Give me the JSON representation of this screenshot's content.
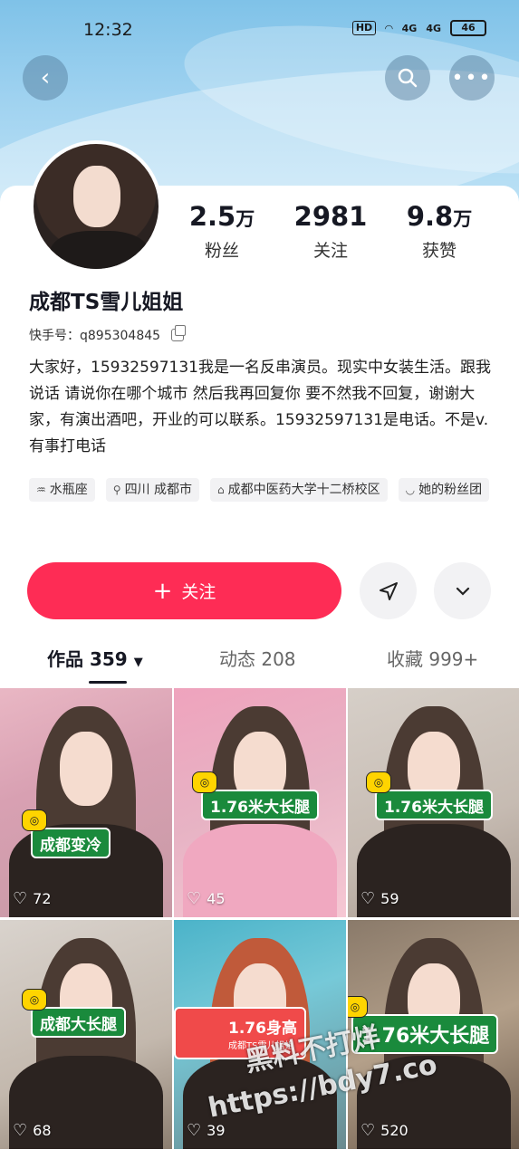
{
  "status_bar": {
    "time": "12:32",
    "hd": "HD",
    "sig1": "4G",
    "sig2": "4G",
    "battery": "46"
  },
  "header": {
    "back_icon": "chevron-left-icon",
    "search_icon": "search-icon",
    "more_icon": "ellipsis-icon"
  },
  "profile": {
    "stats": [
      {
        "num": "2.5",
        "unit": "万",
        "label": "粉丝"
      },
      {
        "num": "2981",
        "unit": "",
        "label": "关注"
      },
      {
        "num": "9.8",
        "unit": "万",
        "label": "获赞"
      }
    ],
    "username": "成都TS雪儿姐姐",
    "kuaishou_id": "快手号：q895304845",
    "bio": "大家好，15932597131我是一名反串演员。现实中女装生活。跟我说话 请说你在哪个城市 然后我再回复你 要不然我不回复，谢谢大家，有演出酒吧，开业的可以联系。15932597131是电话。不是v.有事打电话",
    "tags": [
      "水瓶座",
      "四川 成都市",
      "成都中医药大学十二桥校区",
      "她的粉丝团"
    ]
  },
  "actions": {
    "follow_label": "关注"
  },
  "tabs": [
    {
      "label": "作品 359"
    },
    {
      "label": "动态 208"
    },
    {
      "label": "收藏 999+"
    }
  ],
  "videos": [
    {
      "label": "成都变冷",
      "likes": "72"
    },
    {
      "label": "1.76米大长腿",
      "likes": "45"
    },
    {
      "label": "1.76米大长腿",
      "likes": "59"
    },
    {
      "label": "成都大长腿",
      "likes": "68"
    },
    {
      "label": "1.76身高",
      "sublabel": "成都TS雪儿姐姐",
      "likes": "39"
    },
    {
      "label": "1.76米大长腿",
      "likes": "520"
    }
  ],
  "watermark": {
    "line1": "黑料不打烊",
    "line2": "https://bdy7.co"
  },
  "colors": {
    "follow": "#fe2c55",
    "label_green": "#1a8a3c",
    "badge_yellow": "#ffd400"
  }
}
